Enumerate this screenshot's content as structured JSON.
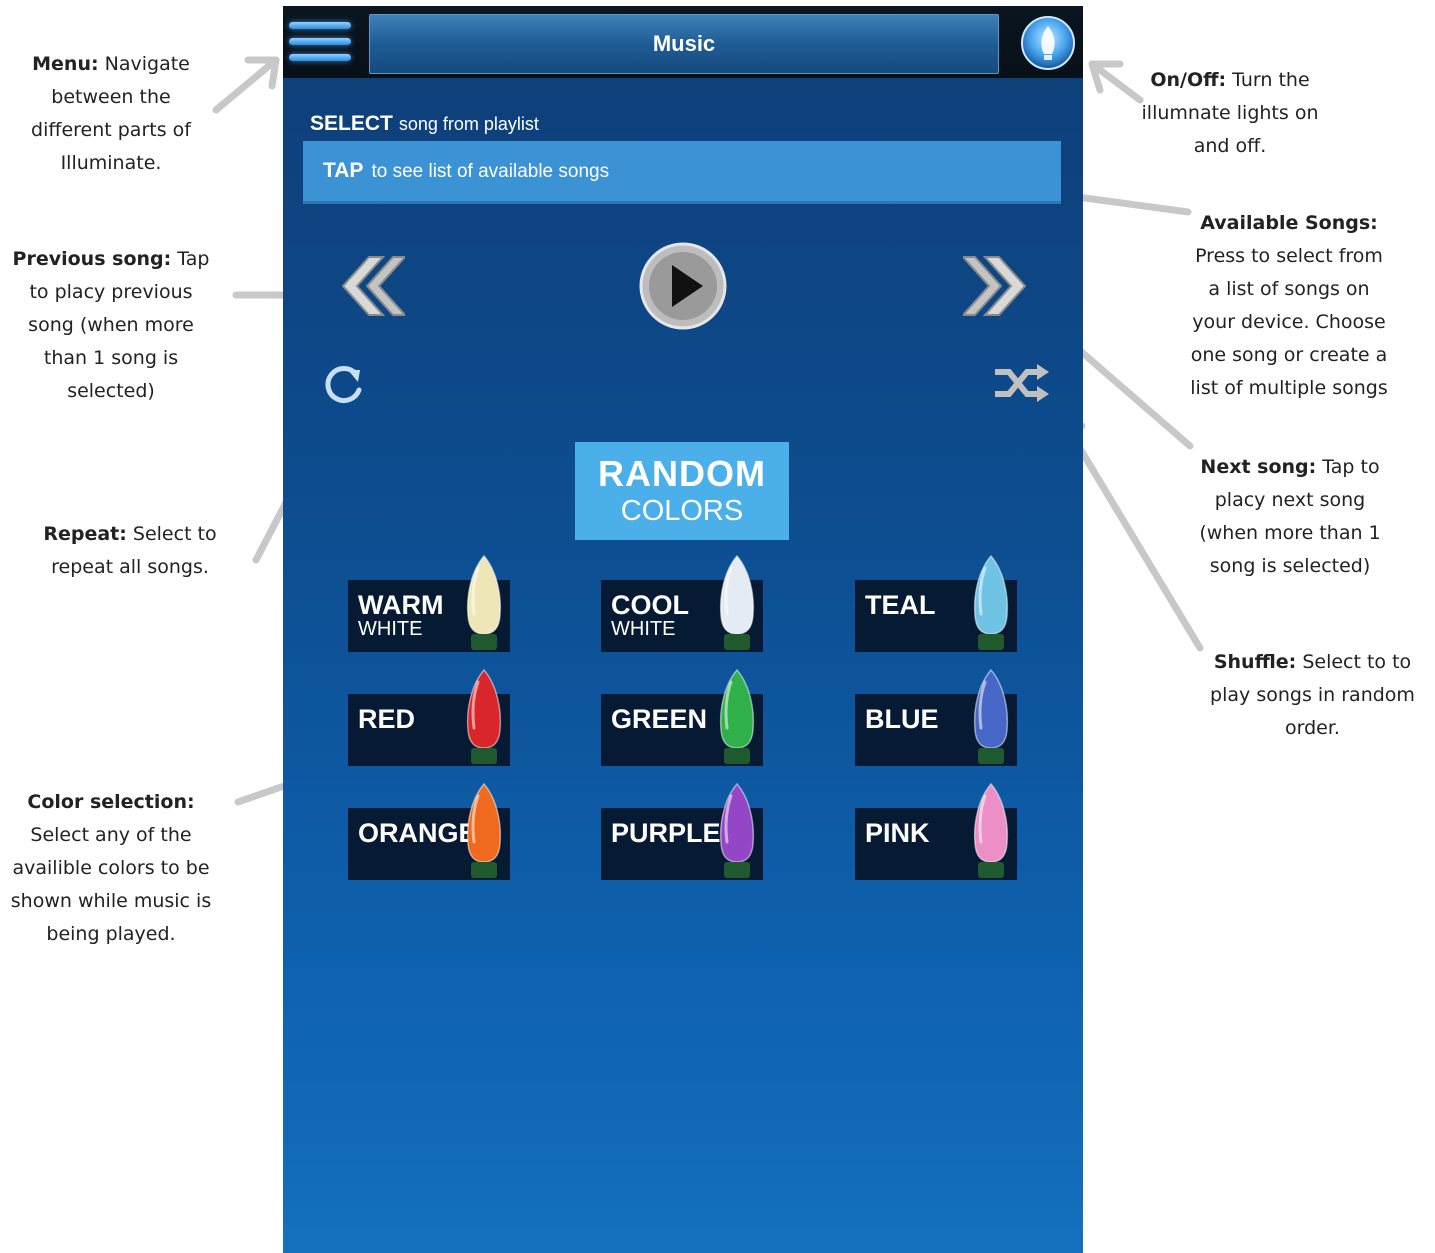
{
  "app": {
    "title": "Music"
  },
  "playlist": {
    "select_strong": "SELECT",
    "select_rest": "song from playlist",
    "tap_strong": "TAP",
    "tap_rest": "to see list of available songs"
  },
  "random": {
    "line1": "RANDOM",
    "line2": "COLORS"
  },
  "colors": [
    {
      "name": "WARM",
      "sub": "WHITE",
      "color": "#efe6b8"
    },
    {
      "name": "COOL",
      "sub": "WHITE",
      "color": "#e4ebf2"
    },
    {
      "name": "TEAL",
      "sub": "",
      "color": "#6fc4e6"
    },
    {
      "name": "RED",
      "sub": "",
      "color": "#d9262a"
    },
    {
      "name": "GREEN",
      "sub": "",
      "color": "#2fb04a"
    },
    {
      "name": "BLUE",
      "sub": "",
      "color": "#4667c8"
    },
    {
      "name": "ORANGE",
      "sub": "",
      "color": "#ef6a1e"
    },
    {
      "name": "PURPLE",
      "sub": "",
      "color": "#9346c6"
    },
    {
      "name": "PINK",
      "sub": "",
      "color": "#eb8fc6"
    }
  ],
  "annotations": {
    "menu": {
      "title": "Menu:",
      "text1": "Navigate",
      "text2": "between the",
      "text3": "different parts of",
      "text4": "Illuminate."
    },
    "onoff": {
      "title": "On/Off:",
      "text1": "Turn the",
      "text2": "illumnate lights on",
      "text3": "and off."
    },
    "available": {
      "title": "Available Songs:",
      "text1": "Press to select from",
      "text2": "a list of songs on",
      "text3": "your device.  Choose",
      "text4": "one song or create a",
      "text5": "list of multiple songs"
    },
    "previous": {
      "title": "Previous song:",
      "text1": "Tap",
      "text2": "to placy previous",
      "text3": "song (when more",
      "text4": "than 1 song is",
      "text5": "selected)"
    },
    "next": {
      "title": "Next song:",
      "text1": "Tap to",
      "text2": "placy next song",
      "text3": "(when more than 1",
      "text4": "song is selected)"
    },
    "repeat": {
      "title": "Repeat:",
      "text1": "Select to",
      "text2": "repeat all songs."
    },
    "shuffle": {
      "title": "Shuffle:",
      "text1": "Select to to",
      "text2": "play songs in random",
      "text3": "order."
    },
    "color": {
      "title": "Color selection:",
      "text1": "Select any of the",
      "text2": "availible colors to be",
      "text3": "shown while music is",
      "text4": "being played."
    }
  }
}
